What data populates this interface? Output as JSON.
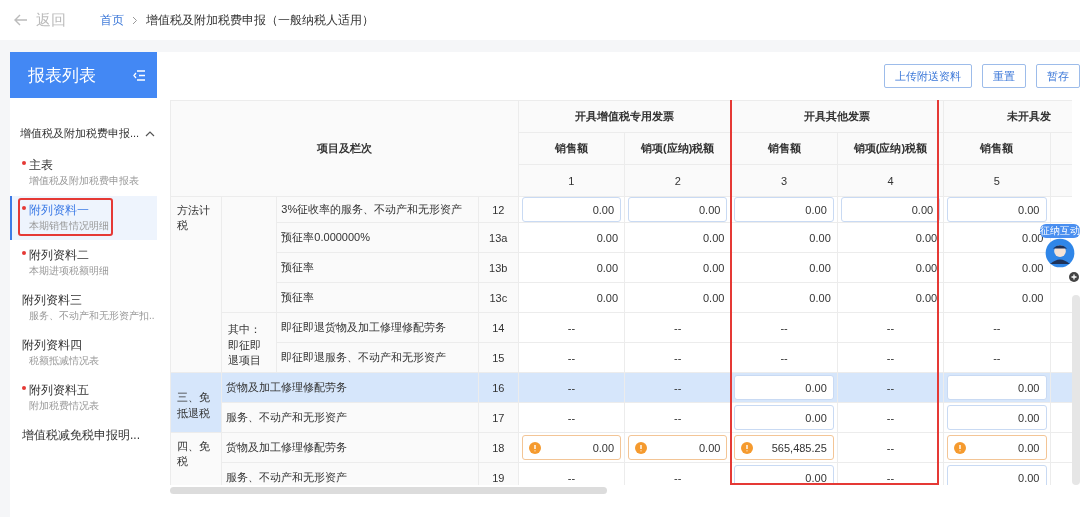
{
  "topbar": {
    "back": "返回",
    "breadcrumb": [
      {
        "label": "首页",
        "kind": "link"
      },
      {
        "label": "增值税及附加税费申报（一般纳税人适用）",
        "kind": "current"
      }
    ]
  },
  "sidebar": {
    "title": "报表列表",
    "group": {
      "label": "增值税及附加税费申报...",
      "expanded": true
    },
    "items": [
      {
        "title": "主表",
        "subtitle": "增值税及附加税费申报表",
        "required": true,
        "selected": false,
        "highlighted": false
      },
      {
        "title": "附列资料一",
        "subtitle": "本期销售情况明细",
        "required": true,
        "selected": true,
        "highlighted": true
      },
      {
        "title": "附列资料二",
        "subtitle": "本期进项税额明细",
        "required": true,
        "selected": false,
        "highlighted": false
      },
      {
        "title": "附列资料三",
        "subtitle": "服务、不动产和无形资产扣..",
        "required": false,
        "selected": false,
        "highlighted": false
      },
      {
        "title": "附列资料四",
        "subtitle": "税额抵减情况表",
        "required": false,
        "selected": false,
        "highlighted": false
      },
      {
        "title": "附列资料五",
        "subtitle": "附加税费情况表",
        "required": true,
        "selected": false,
        "highlighted": false
      },
      {
        "title": "增值税减免税申报明...",
        "required": false,
        "selected": false,
        "highlighted": false
      }
    ]
  },
  "toolbar": {
    "buttons": [
      "上传附送资料",
      "重置",
      "暂存"
    ]
  },
  "table": {
    "item_header": "项目及栏次",
    "column_groups": [
      {
        "label": "开具增值税专用发票",
        "highlighted": false,
        "columns": [
          {
            "label": "销售额",
            "number": "1"
          },
          {
            "label": "销项(应纳)税额",
            "number": "2"
          }
        ]
      },
      {
        "label": "开具其他发票",
        "highlighted": true,
        "columns": [
          {
            "label": "销售额",
            "number": "3"
          },
          {
            "label": "销项(应纳)税额",
            "number": "4"
          }
        ]
      },
      {
        "label": "未开具发",
        "highlighted": false,
        "columns": [
          {
            "label": "销售额",
            "number": "5"
          }
        ]
      }
    ],
    "sections": [
      {
        "label": "方法计税",
        "selected": false,
        "subgroups": [
          {
            "rows": [
              {
                "item": "3%征收率的服务、不动产和无形资产",
                "line": "12",
                "selected": false,
                "cells": [
                  {
                    "kind": "input",
                    "value": "0.00"
                  },
                  {
                    "kind": "input",
                    "value": "0.00"
                  },
                  {
                    "kind": "input",
                    "value": "0.00"
                  },
                  {
                    "kind": "input",
                    "value": "0.00"
                  },
                  {
                    "kind": "input",
                    "value": "0.00"
                  }
                ]
              },
              {
                "item": "预征率0.000000%",
                "line": "13a",
                "selected": false,
                "cells": [
                  {
                    "kind": "text",
                    "value": "0.00"
                  },
                  {
                    "kind": "text",
                    "value": "0.00"
                  },
                  {
                    "kind": "text",
                    "value": "0.00"
                  },
                  {
                    "kind": "text",
                    "value": "0.00"
                  },
                  {
                    "kind": "text",
                    "value": "0.00"
                  }
                ]
              },
              {
                "item": "预征率",
                "line": "13b",
                "selected": false,
                "cells": [
                  {
                    "kind": "text",
                    "value": "0.00"
                  },
                  {
                    "kind": "text",
                    "value": "0.00"
                  },
                  {
                    "kind": "text",
                    "value": "0.00"
                  },
                  {
                    "kind": "text",
                    "value": "0.00"
                  },
                  {
                    "kind": "text",
                    "value": "0.00"
                  }
                ]
              },
              {
                "item": "预征率",
                "line": "13c",
                "selected": false,
                "cells": [
                  {
                    "kind": "text",
                    "value": "0.00"
                  },
                  {
                    "kind": "text",
                    "value": "0.00"
                  },
                  {
                    "kind": "text",
                    "value": "0.00"
                  },
                  {
                    "kind": "text",
                    "value": "0.00"
                  },
                  {
                    "kind": "text",
                    "value": "0.00"
                  }
                ]
              }
            ]
          },
          {
            "label": "其中：即征即退项目",
            "rows": [
              {
                "item": "即征即退货物及加工修理修配劳务",
                "line": "14",
                "selected": false,
                "cells": [
                  {
                    "kind": "dash",
                    "value": "--"
                  },
                  {
                    "kind": "dash",
                    "value": "--"
                  },
                  {
                    "kind": "dash",
                    "value": "--"
                  },
                  {
                    "kind": "dash",
                    "value": "--"
                  },
                  {
                    "kind": "dash",
                    "value": "--"
                  }
                ]
              },
              {
                "item": "即征即退服务、不动产和无形资产",
                "line": "15",
                "selected": false,
                "cells": [
                  {
                    "kind": "dash",
                    "value": "--"
                  },
                  {
                    "kind": "dash",
                    "value": "--"
                  },
                  {
                    "kind": "dash",
                    "value": "--"
                  },
                  {
                    "kind": "dash",
                    "value": "--"
                  },
                  {
                    "kind": "dash",
                    "value": "--"
                  }
                ]
              }
            ]
          }
        ]
      },
      {
        "label": "三、免抵退税",
        "selected": true,
        "rows": [
          {
            "item": "货物及加工修理修配劳务",
            "line": "16",
            "selected": true,
            "cells": [
              {
                "kind": "dash",
                "value": "--"
              },
              {
                "kind": "dash",
                "value": "--"
              },
              {
                "kind": "input",
                "value": "0.00"
              },
              {
                "kind": "dash",
                "value": "--"
              },
              {
                "kind": "input",
                "value": "0.00"
              }
            ]
          },
          {
            "item": "服务、不动产和无形资产",
            "line": "17",
            "selected": false,
            "cells": [
              {
                "kind": "dash",
                "value": "--"
              },
              {
                "kind": "dash",
                "value": "--"
              },
              {
                "kind": "input",
                "value": "0.00"
              },
              {
                "kind": "dash",
                "value": "--"
              },
              {
                "kind": "input",
                "value": "0.00"
              }
            ]
          }
        ]
      },
      {
        "label": "四、免税",
        "selected": false,
        "rows": [
          {
            "item": "货物及加工修理修配劳务",
            "line": "18",
            "selected": false,
            "cells": [
              {
                "kind": "warn",
                "value": "0.00"
              },
              {
                "kind": "warn",
                "value": "0.00"
              },
              {
                "kind": "warn",
                "value": "565,485.25"
              },
              {
                "kind": "dash",
                "value": "--"
              },
              {
                "kind": "warn",
                "value": "0.00"
              }
            ]
          },
          {
            "item": "服务、不动产和无形资产",
            "line": "19",
            "selected": false,
            "cells": [
              {
                "kind": "dash",
                "value": "--"
              },
              {
                "kind": "dash",
                "value": "--"
              },
              {
                "kind": "input",
                "value": "0.00"
              },
              {
                "kind": "dash",
                "value": "--"
              },
              {
                "kind": "input",
                "value": "0.00"
              }
            ]
          }
        ]
      }
    ]
  },
  "assistant": {
    "label": "征纳互动"
  }
}
